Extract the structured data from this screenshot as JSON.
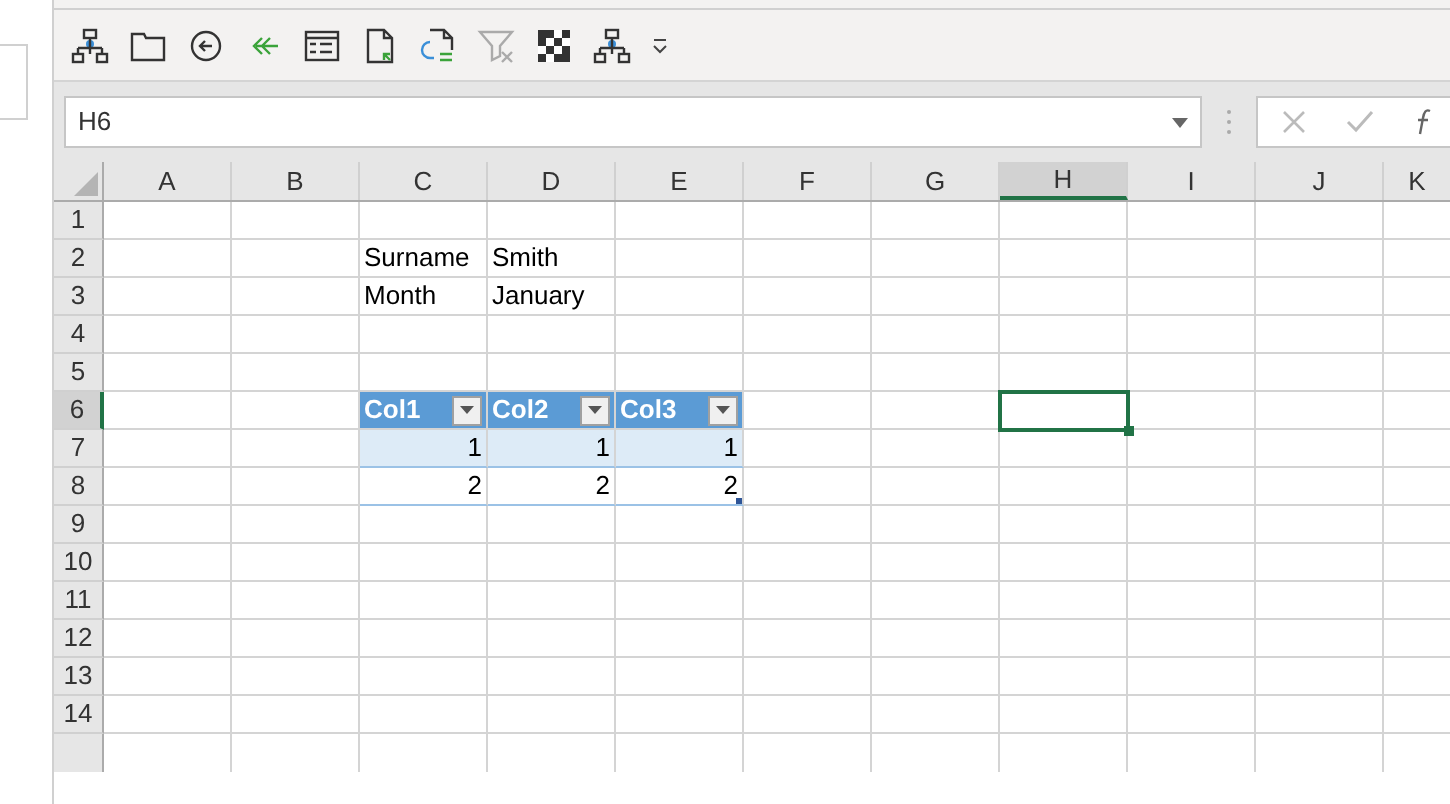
{
  "name_box": {
    "value": "H6"
  },
  "columns": [
    {
      "label": "A",
      "selected": false
    },
    {
      "label": "B",
      "selected": false
    },
    {
      "label": "C",
      "selected": false
    },
    {
      "label": "D",
      "selected": false
    },
    {
      "label": "E",
      "selected": false
    },
    {
      "label": "F",
      "selected": false
    },
    {
      "label": "G",
      "selected": false
    },
    {
      "label": "H",
      "selected": true
    },
    {
      "label": "I",
      "selected": false
    },
    {
      "label": "J",
      "selected": false
    },
    {
      "label": "K",
      "selected": false
    }
  ],
  "rows": [
    {
      "label": "1",
      "selected": false,
      "cells": []
    },
    {
      "label": "2",
      "selected": false,
      "cells": [
        {},
        {},
        {
          "text": "Surname",
          "kind": "text"
        },
        {
          "text": "Smith",
          "kind": "text"
        }
      ]
    },
    {
      "label": "3",
      "selected": false,
      "cells": [
        {},
        {},
        {
          "text": "Month",
          "kind": "text"
        },
        {
          "text": "January",
          "kind": "text"
        }
      ]
    },
    {
      "label": "4",
      "selected": false,
      "cells": []
    },
    {
      "label": "5",
      "selected": false,
      "cells": []
    },
    {
      "label": "6",
      "selected": true,
      "cells": [
        {},
        {},
        {
          "text": "Col1",
          "kind": "table_header"
        },
        {
          "text": "Col2",
          "kind": "table_header"
        },
        {
          "text": "Col3",
          "kind": "table_header"
        },
        {},
        {},
        {
          "selected": true
        }
      ]
    },
    {
      "label": "7",
      "selected": false,
      "cells": [
        {},
        {},
        {
          "text": "1",
          "kind": "table_band"
        },
        {
          "text": "1",
          "kind": "table_band"
        },
        {
          "text": "1",
          "kind": "table_band"
        }
      ]
    },
    {
      "label": "8",
      "selected": false,
      "cells": [
        {},
        {},
        {
          "text": "2",
          "kind": "table_row"
        },
        {
          "text": "2",
          "kind": "table_row"
        },
        {
          "text": "2",
          "kind": "table_row_last"
        }
      ]
    },
    {
      "label": "9",
      "selected": false,
      "cells": []
    },
    {
      "label": "10",
      "selected": false,
      "cells": []
    },
    {
      "label": "11",
      "selected": false,
      "cells": []
    },
    {
      "label": "12",
      "selected": false,
      "cells": []
    },
    {
      "label": "13",
      "selected": false,
      "cells": []
    },
    {
      "label": "14",
      "selected": false,
      "cells": []
    }
  ]
}
